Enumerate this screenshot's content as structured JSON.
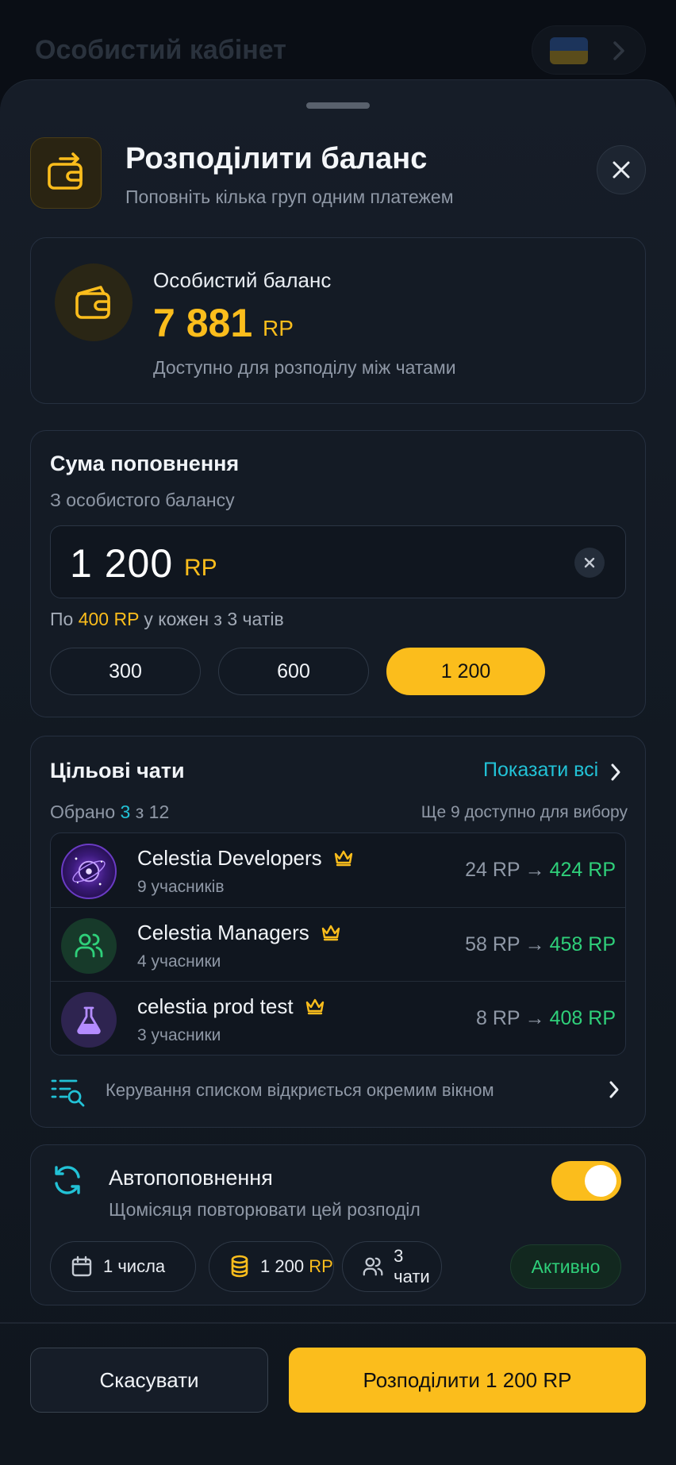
{
  "background": {
    "title": "Особистий кабінет"
  },
  "header": {
    "title": "Розподілити баланс",
    "subtitle": "Поповніть кілька груп одним платежем"
  },
  "balance": {
    "label": "Особистий баланс",
    "amount": "7 881",
    "unit": "RP",
    "hint": "Доступно для розподілу між чатами"
  },
  "amount": {
    "title": "Сума поповнення",
    "subtitle": "З особистого балансу",
    "value": "1 200",
    "unit": "RP",
    "per_chat_prefix": "По",
    "per_chat_value": "400 RP",
    "per_chat_suffix": "у кожен з 3 чатів",
    "presets": [
      "300",
      "600",
      "1 200"
    ],
    "active_preset_index": 2
  },
  "chats": {
    "title": "Цільові чати",
    "show_all": "Показати всі",
    "selected_prefix": "Обрано",
    "selected_count": "3",
    "selected_suffix": "з 12",
    "available": "Ще 9 доступно для вибору",
    "items": [
      {
        "name": "Celestia Developers",
        "members": "9 учасників",
        "from": "24 RP",
        "arrow": "→",
        "to": "424 RP",
        "icon": "galaxy-avatar"
      },
      {
        "name": "Celestia Managers",
        "members": "4 учасники",
        "from": "58 RP",
        "arrow": "→",
        "to": "458 RP",
        "icon": "users-icon"
      },
      {
        "name": "celestia prod test",
        "members": "3 учасники",
        "from": "8 RP",
        "arrow": "→",
        "to": "408 RP",
        "icon": "flask-icon"
      }
    ],
    "manage_text": "Керування списком відкриється окремим вікном"
  },
  "autopay": {
    "title": "Автопоповнення",
    "subtitle": "Щомісяця повторювати цей розподіл",
    "enabled": true,
    "day": "1 числа",
    "sum_value": "1 200",
    "sum_unit": "RP",
    "chats": "3 чати",
    "status": "Активно"
  },
  "footer": {
    "cancel": "Скасувати",
    "submit": "Розподілити 1 200 RP"
  },
  "colors": {
    "accent": "#fbbd1c",
    "link": "#22c2d6",
    "positive": "#2fd07a",
    "background": "#0a0e15"
  }
}
